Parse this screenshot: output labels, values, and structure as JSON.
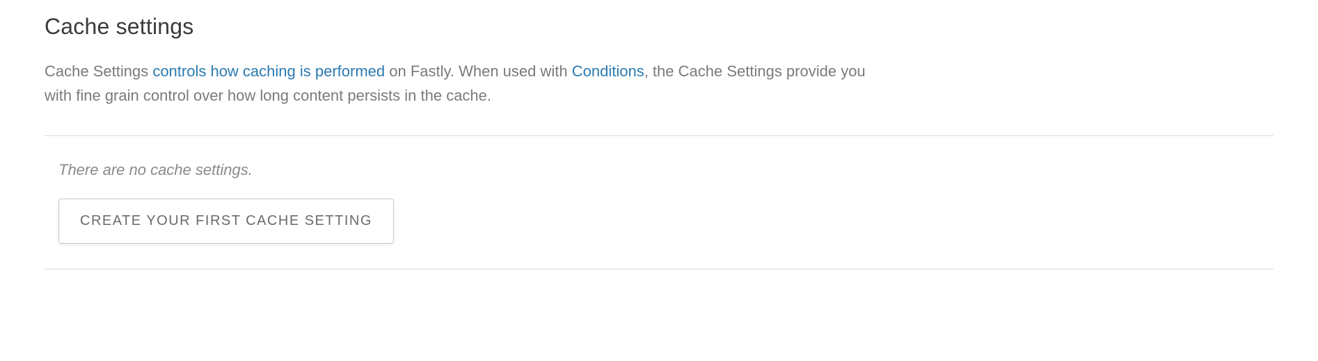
{
  "header": {
    "title": "Cache settings"
  },
  "description": {
    "part1": "Cache Settings ",
    "link1": "controls how caching is performed",
    "part2": " on Fastly. When used with ",
    "link2": "Conditions",
    "part3": ", the Cache Settings provide you with fine grain control over how long content persists in the cache."
  },
  "empty_state": {
    "message": "There are no cache settings.",
    "button_label": "CREATE YOUR FIRST CACHE SETTING"
  }
}
